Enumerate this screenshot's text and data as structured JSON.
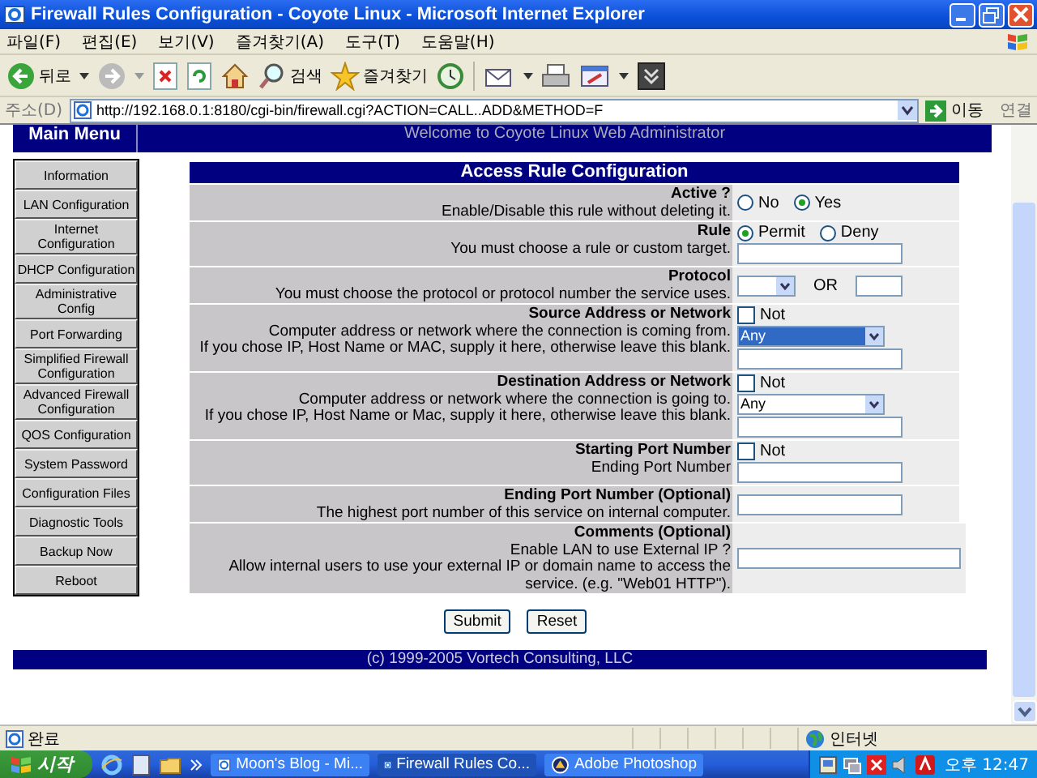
{
  "window": {
    "title": "Firewall Rules Configuration - Coyote Linux - Microsoft Internet Explorer"
  },
  "menu_bar": [
    "파일(F)",
    "편집(E)",
    "보기(V)",
    "즐겨찾기(A)",
    "도구(T)",
    "도움말(H)"
  ],
  "toolbar": {
    "back_label": "뒤로",
    "search_label": "검색",
    "favorites_label": "즐겨찾기"
  },
  "address_bar": {
    "label": "주소(D)",
    "url": "http://192.168.0.1:8180/cgi-bin/firewall.cgi?ACTION=CALL..ADD&METHOD=F",
    "go_label": "이동",
    "links_label": "연결"
  },
  "banner": {
    "menu_title": "Main Menu",
    "welcome": "Welcome to Coyote Linux Web Administrator"
  },
  "sidebar": {
    "items": [
      "Information",
      "LAN Configuration",
      "Internet Configuration",
      "DHCP Configuration",
      "Administrative Config",
      "Port Forwarding",
      "Simplified Firewall Configuration",
      "Advanced Firewall Configuration",
      "QOS Configuration",
      "System Password",
      "Configuration Files",
      "Diagnostic Tools",
      "Backup Now",
      "Reboot"
    ]
  },
  "form": {
    "title": "Access Rule Configuration",
    "rows": [
      {
        "kind": "radio",
        "title": "Active ?",
        "description": [
          "Enable/Disable this rule without deleting it."
        ],
        "options": [
          {
            "label": "No",
            "selected": false
          },
          {
            "label": "Yes",
            "selected": true
          }
        ]
      },
      {
        "kind": "radio_field",
        "title": "Rule",
        "description": [
          "You must choose a rule or custom target."
        ],
        "options": [
          {
            "label": "Permit",
            "selected": true
          },
          {
            "label": "Deny",
            "selected": false
          }
        ]
      },
      {
        "kind": "select_or",
        "title": "Protocol",
        "description": [
          "You must choose the protocol or protocol number the service uses."
        ],
        "or_label": "OR"
      },
      {
        "kind": "address",
        "title": "Source Address or Network",
        "description": [
          "Computer address or network where the connection is coming from.",
          "If you chose IP, Host Name or MAC, supply it here, otherwise leave this blank."
        ],
        "not_label": "Not",
        "not_checked": false,
        "select_value": "Any",
        "select_focused": true
      },
      {
        "kind": "address",
        "title": "Destination Address or Network",
        "description": [
          "Computer address or network where the connection is going to.",
          "If you chose IP, Host Name or Mac, supply it here, otherwise leave this blank."
        ],
        "not_label": "Not",
        "not_checked": false,
        "select_value": "Any",
        "select_focused": false
      },
      {
        "kind": "port",
        "title": "Starting Port Number",
        "description": [
          "Ending Port Number"
        ],
        "not_label": "Not",
        "not_checked": false
      },
      {
        "kind": "field",
        "title": "Ending Port Number (Optional)",
        "description": [
          "The highest port number of this service on internal computer."
        ]
      },
      {
        "kind": "wide_field",
        "title": "Comments (Optional)",
        "description": [
          "Enable LAN to use External IP ?",
          "Allow internal users to use your external IP or domain name to access the service. (e.g. \"Web01 HTTP\")."
        ]
      }
    ]
  },
  "buttons": [
    "Submit",
    "Reset"
  ],
  "footer": "(c) 1999-2005 Vortech Consulting, LLC",
  "status_bar": {
    "status": "완료",
    "zone": "인터넷"
  },
  "taskbar": {
    "start_label": "시작",
    "tasks": [
      {
        "label": "Moon's Blog - Mi...",
        "selected": false
      },
      {
        "label": "Firewall Rules Co...",
        "selected": true
      },
      {
        "label": "Adobe Photoshop",
        "selected": false
      }
    ],
    "clock": "오후 12:47"
  }
}
